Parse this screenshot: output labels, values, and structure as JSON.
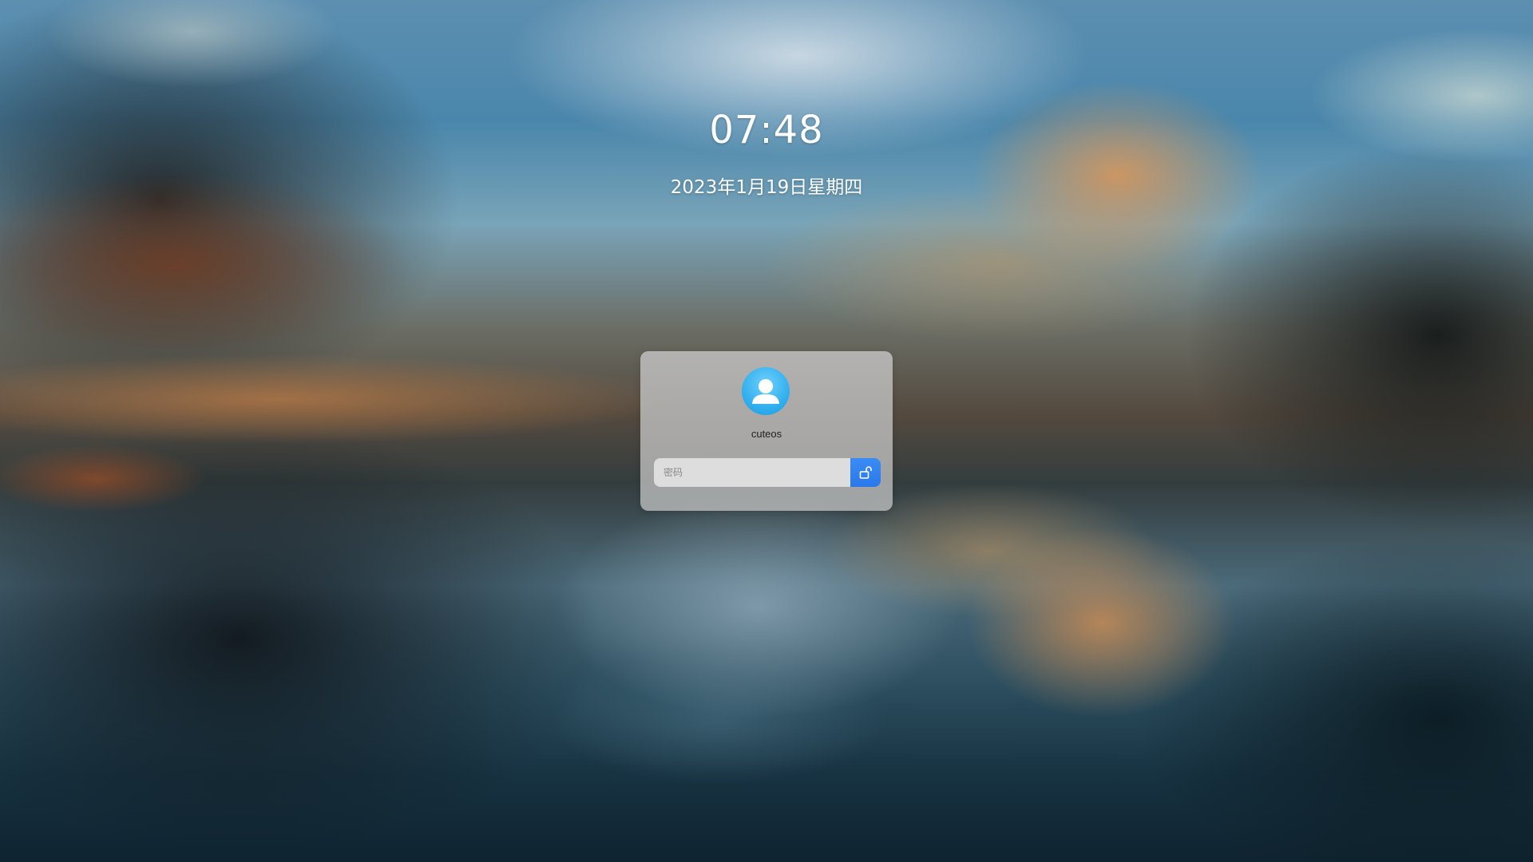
{
  "lockscreen": {
    "time": "07:48",
    "date": "2023年1月19日星期四"
  },
  "login": {
    "username": "cuteos",
    "avatar_icon": "user-silhouette-icon",
    "password_placeholder": "密码",
    "unlock_icon": "unlock-icon"
  },
  "colors": {
    "accent": "#2a78ea",
    "avatar": "#33b0ee"
  }
}
